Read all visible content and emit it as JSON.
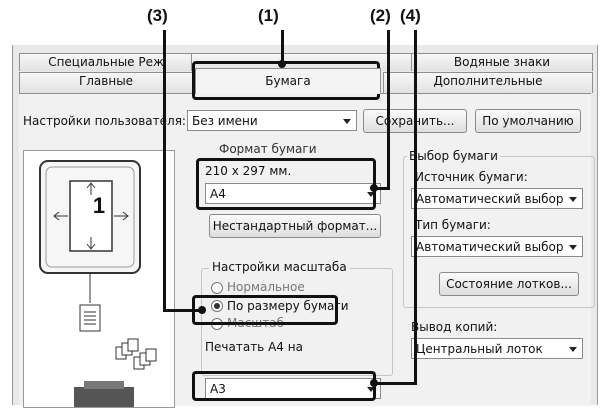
{
  "callouts": {
    "c1": "(1)",
    "c2": "(2)",
    "c3": "(3)",
    "c4": "(4)"
  },
  "tabs": {
    "special_modes": "Специальные Реж",
    "watermarks": "Водяные знаки",
    "main": "Главные",
    "paper": "Бумага",
    "advanced": "Дополнительные"
  },
  "user_settings": {
    "label": "Настройки пользователя:",
    "value": "Без имени",
    "save_button": "Сохранить...",
    "default_button": "По умолчанию"
  },
  "preview": {
    "page_number": "1"
  },
  "paper_size": {
    "group_label": "Формат бумаги",
    "dimensions": "210 x 297 мм.",
    "selected": "A4",
    "custom_button": "Нестандартный формат..."
  },
  "scaling": {
    "group_label": "Настройки масштаба",
    "normal": "Нормальное",
    "fit_to_paper": "По размеру бумаги",
    "zoom": "Масштаб",
    "print_on_label": "Печатать A4 на",
    "print_on_value": "A3"
  },
  "paper_select": {
    "group_label": "Выбор бумаги",
    "source_label": "Источник бумаги:",
    "source_value": "Автоматический выбор",
    "type_label": "Тип бумаги:",
    "type_value": "Автоматический выбор",
    "tray_status_button": "Состояние лотков..."
  },
  "output": {
    "label": "Вывод копий:",
    "value": "Центральный лоток"
  }
}
